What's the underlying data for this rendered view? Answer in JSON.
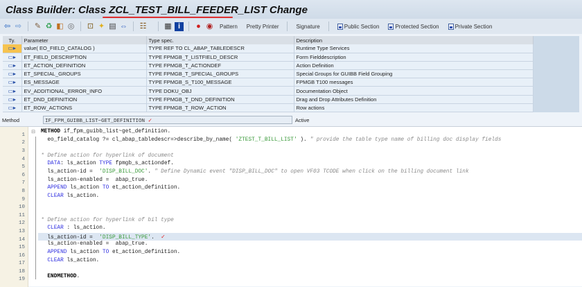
{
  "title": "Class Builder: Class ZCL_TEST_BILL_FEEDER_LIST Change",
  "toolbar": {
    "icons": [
      "back-icon",
      "forward-icon",
      "edit-toggle-icon",
      "check-icon",
      "activate-icon",
      "where-used-icon",
      "object-list-icon",
      "hierarchy-icon",
      "display-object-list-icon",
      "navigation-icon",
      "module-icon",
      "layout-icon",
      "info-icon",
      "breakpoint-icon",
      "user-breakpoint-icon"
    ],
    "pattern": "Pattern",
    "pretty_printer": "Pretty Printer",
    "signature": "Signature",
    "public_section": "Public Section",
    "protected_section": "Protected Section",
    "private_section": "Private Section"
  },
  "params": {
    "headers": {
      "ty": "Ty.",
      "param": "Parameter",
      "type": "Type spec.",
      "desc": "Description"
    },
    "rows": [
      {
        "param": "value( EO_FIELD_CATALOG )",
        "type": "TYPE REF TO CL_ABAP_TABLEDESCR",
        "desc": "Runtime Type Services"
      },
      {
        "param": "ET_FIELD_DESCRIPTION",
        "type": "TYPE FPMGB_T_LISTFIELD_DESCR",
        "desc": "Form Fielddescription"
      },
      {
        "param": "ET_ACTION_DEFINITION",
        "type": "TYPE FPMGB_T_ACTIONDEF",
        "desc": "Action Definition"
      },
      {
        "param": "ET_SPECIAL_GROUPS",
        "type": "TYPE FPMGB_T_SPECIAL_GROUPS",
        "desc": "Special Groups for GUIBB Field Grouping"
      },
      {
        "param": "ES_MESSAGE",
        "type": "TYPE FPMGB_S_T100_MESSAGE",
        "desc": "FPMGB T100 messages"
      },
      {
        "param": "EV_ADDITIONAL_ERROR_INFO",
        "type": "TYPE DOKU_OBJ",
        "desc": "Documentation Object"
      },
      {
        "param": "ET_DND_DEFINITION",
        "type": "TYPE FPMGB_T_DND_DEFINITION",
        "desc": "Drag and Drop Attributes Definition"
      },
      {
        "param": "ET_ROW_ACTIONS",
        "type": "TYPE FPMGB_T_ROW_ACTION",
        "desc": "Row actions"
      }
    ]
  },
  "method": {
    "label": "Method",
    "value": "IF_FPM_GUIBB_LIST~GET_DEFINITION",
    "status": "Active"
  },
  "code": [
    [
      {
        "c": "kwb",
        "t": "METHOD"
      },
      {
        "t": " if_fpm_guibb_list~get_definition."
      }
    ],
    [
      {
        "t": "  eo_field_catalog ?= cl_abap_tabledescr=>describe_by_name( "
      },
      {
        "c": "str",
        "t": "'ZTEST_T_BILL_LIST'"
      },
      {
        "t": " ). "
      },
      {
        "c": "com",
        "t": "\" provide the table type name of billing doc display fields"
      }
    ],
    [],
    [
      {
        "c": "com",
        "t": "* Define action for hyperlink of document"
      }
    ],
    [
      {
        "t": "  "
      },
      {
        "c": "kw",
        "t": "DATA"
      },
      {
        "t": ": ls_action "
      },
      {
        "c": "kw",
        "t": "TYPE"
      },
      {
        "t": " fpmgb_s_actiondef."
      }
    ],
    [
      {
        "t": "  ls_action-id =  "
      },
      {
        "c": "str",
        "t": "'DISP_BILL_DOC'"
      },
      {
        "t": ". "
      },
      {
        "c": "com",
        "t": "\" Define Dynamic event \"DISP_BILL_DOC\" to open VF03 TCODE when click on the billing document link"
      }
    ],
    [
      {
        "t": "  ls_action-enabled =  abap_true."
      }
    ],
    [
      {
        "t": "  "
      },
      {
        "c": "kw",
        "t": "APPEND"
      },
      {
        "t": " ls_action "
      },
      {
        "c": "kw",
        "t": "TO"
      },
      {
        "t": " et_action_definition."
      }
    ],
    [
      {
        "t": "  "
      },
      {
        "c": "kw",
        "t": "CLEAR"
      },
      {
        "t": " ls_action."
      }
    ],
    [],
    [],
    [
      {
        "c": "com",
        "t": "* Define action for hyperlink of bil type"
      }
    ],
    [
      {
        "t": "  "
      },
      {
        "c": "kw",
        "t": "CLEAR"
      },
      {
        "t": " : ls_action."
      }
    ],
    [
      {
        "t": "  ls_action-id =  "
      },
      {
        "c": "str",
        "t": "'DISP_BILL_TYPE'"
      },
      {
        "t": ".  "
      }
    ],
    [
      {
        "t": "  ls_action-enabled =  abap_true."
      }
    ],
    [
      {
        "t": "  "
      },
      {
        "c": "kw",
        "t": "APPEND"
      },
      {
        "t": " ls_action "
      },
      {
        "c": "kw",
        "t": "TO"
      },
      {
        "t": " et_action_definition."
      }
    ],
    [
      {
        "t": "  "
      },
      {
        "c": "kw",
        "t": "CLEAR"
      },
      {
        "t": " ls_action."
      }
    ],
    [],
    [
      {
        "t": "  "
      },
      {
        "c": "kwb",
        "t": "ENDMETHOD"
      },
      {
        "t": "."
      }
    ]
  ],
  "highlight_line": 14,
  "checkmark_line": 14
}
